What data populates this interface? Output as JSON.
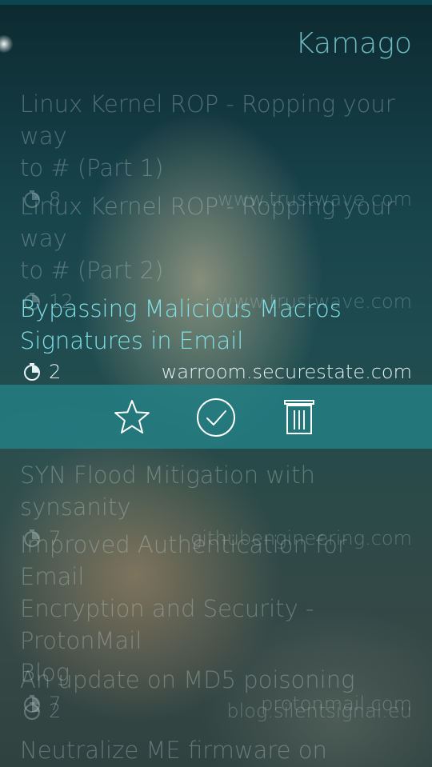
{
  "header": {
    "title": "Kamago"
  },
  "articles": [
    {
      "title": "Linux Kernel ROP - Ropping your way\nto # (Part 1)",
      "minutes": "8",
      "domain": "www.trustwave.com"
    },
    {
      "title": "Linux Kernel ROP - Ropping your way\nto # (Part 2)",
      "minutes": "12",
      "domain": "www.trustwave.com"
    },
    {
      "title": "Bypassing Malicious Macros\nSignatures in Email",
      "minutes": "2",
      "domain": "warroom.securestate.com",
      "selected": true
    },
    {
      "title": "SYN Flood Mitigation with synsanity",
      "minutes": "7",
      "domain": "githubengineering.com"
    },
    {
      "title": "Improved Authentication for Email\nEncryption and Security - ProtonMail\nBlog",
      "minutes": "7",
      "domain": "protonmail.com"
    },
    {
      "title": "An update on MD5 poisoning",
      "minutes": "2",
      "domain": "blog.silentsignal.eu"
    },
    {
      "title": "Neutralize ME firmware on",
      "minutes": "",
      "domain": ""
    }
  ],
  "context_menu": {
    "items": [
      {
        "icon": "star-icon"
      },
      {
        "icon": "checkmark-circle-icon"
      },
      {
        "icon": "trash-icon"
      }
    ]
  },
  "colors": {
    "accent": "#7fe0e6",
    "header": "#6fb9bf",
    "menu_bg": "#237d82"
  }
}
